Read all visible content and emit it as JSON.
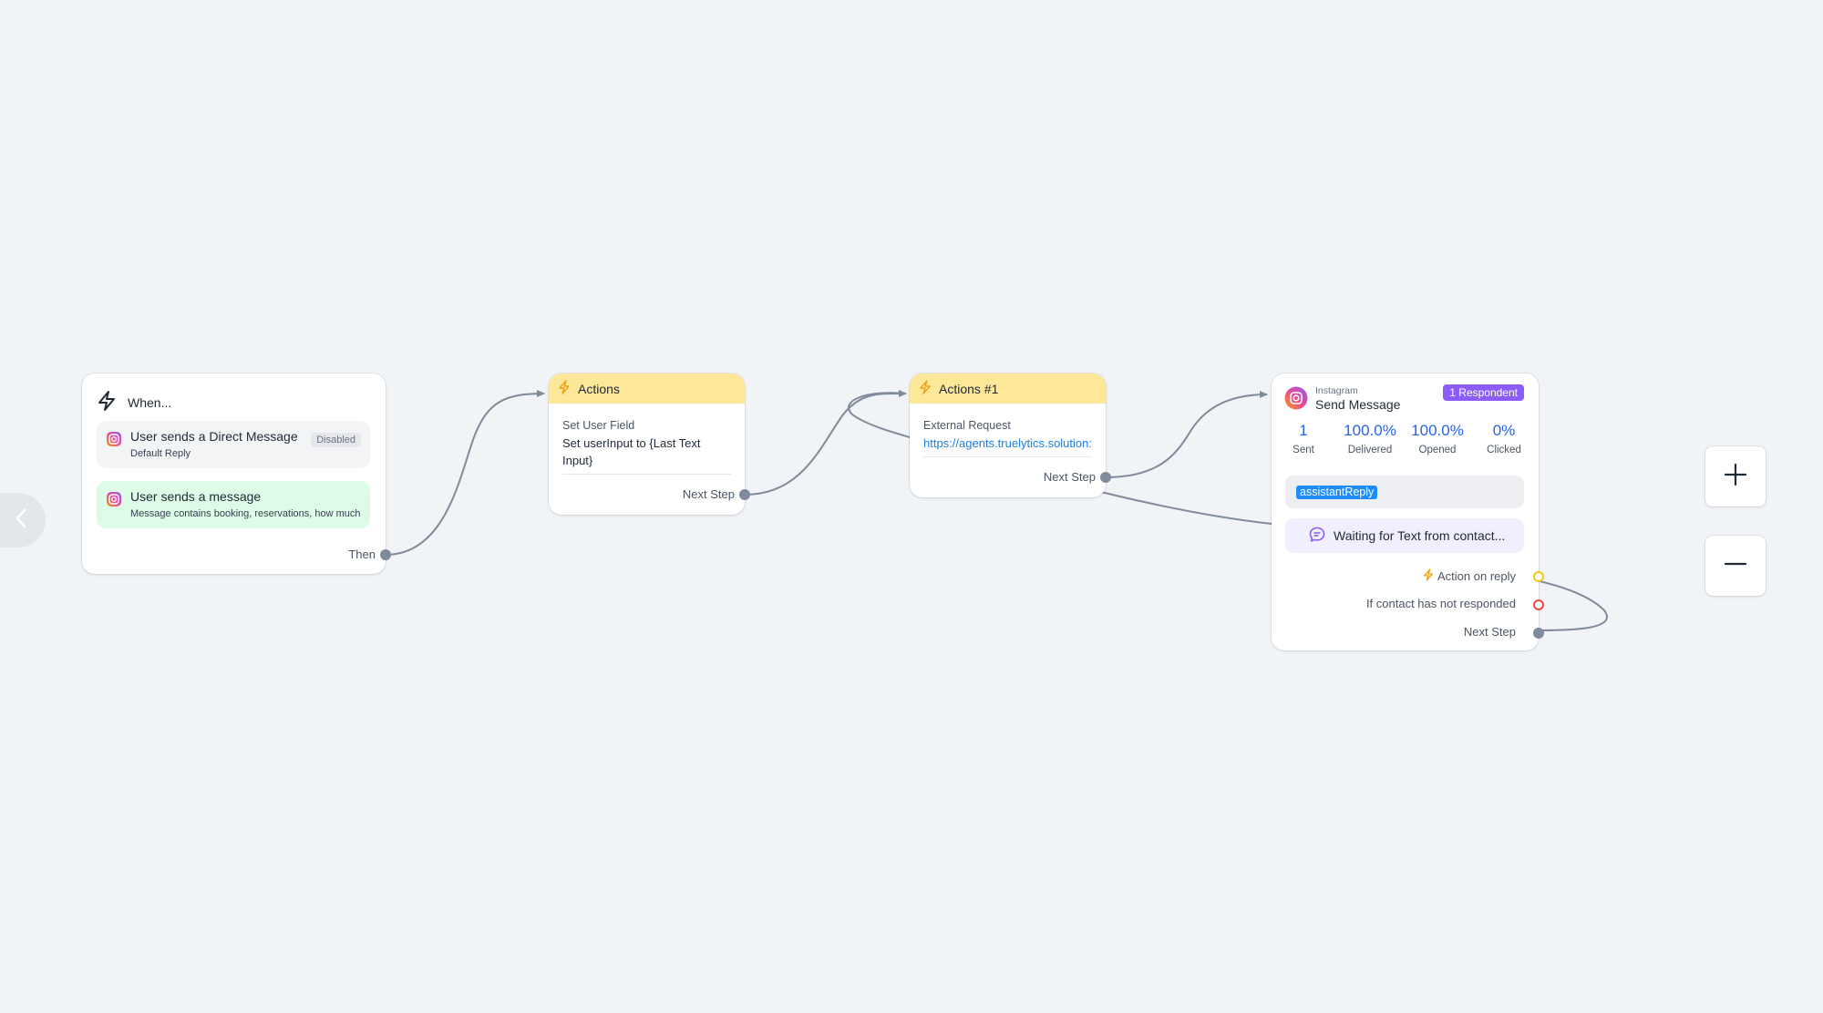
{
  "colors": {
    "background": "#f1f4f7",
    "wire": "#7f8a9a",
    "header_yellow": "#fde89a",
    "accent_blue": "#2563eb",
    "link_blue": "#1d7fe0",
    "respondent_purple": "#8b5cf6",
    "trigger_green": "#dcfce7",
    "ring_yellow": "#f5c518",
    "ring_red": "#ef4444"
  },
  "when_node": {
    "title": "When...",
    "icon": "lightning-outline-icon",
    "triggers": [
      {
        "label": "User sends a Direct Message",
        "sublabel": "Default Reply",
        "badge": "Disabled",
        "icon": "instagram-icon",
        "highlight": false
      },
      {
        "label": "User sends a message",
        "sublabel": "Message contains booking, reservations, how much",
        "icon": "instagram-icon",
        "highlight": true
      }
    ],
    "output_label": "Then"
  },
  "actions_node": {
    "title": "Actions",
    "icon": "lightning-icon",
    "field_label": "Set User Field",
    "field_value": "Set userInput to {Last Text Input}",
    "output_label": "Next Step"
  },
  "actions1_node": {
    "title": "Actions #1",
    "icon": "lightning-icon",
    "field_label": "External Request",
    "field_value": "https://agents.truelytics.solution:",
    "output_label": "Next Step"
  },
  "send_node": {
    "kicker": "Instagram",
    "title": "Send Message",
    "badge": "1 Respondent",
    "stats": [
      {
        "value": "1",
        "label": "Sent"
      },
      {
        "value": "100.0%",
        "label": "Delivered"
      },
      {
        "value": "100.0%",
        "label": "Opened"
      },
      {
        "value": "0%",
        "label": "Clicked"
      }
    ],
    "variable_chip": "assistantReply",
    "waiting_text": "Waiting for Text from contact...",
    "outputs": {
      "action_on_reply": "Action on reply",
      "not_responded": "If contact has not responded",
      "next_step": "Next Step"
    }
  },
  "controls": {
    "zoom_in_icon": "plus-icon",
    "zoom_out_icon": "minus-icon",
    "collapse_icon": "chevron-left-icon"
  }
}
